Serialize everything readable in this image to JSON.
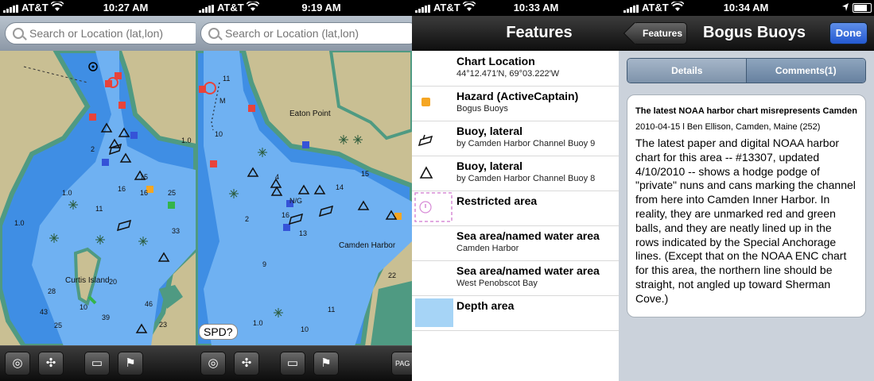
{
  "screens": {
    "map1": {
      "status": {
        "carrier": "AT&T",
        "time": "10:27 AM"
      },
      "search": {
        "placeholder": "Search or Location (lat,lon)"
      },
      "map": {
        "depth_soundings": [
          "1.0",
          "1.0",
          "2",
          "16",
          "11",
          "1.0",
          "15",
          "16",
          "25",
          "33",
          "28",
          "20",
          "43",
          "10",
          "46",
          "39",
          "25",
          "23"
        ],
        "place_labels": [
          "Curtis Island"
        ]
      },
      "toolbar": {
        "buttons": [
          "locate-icon",
          "crosshair-icon",
          "ruler-icon",
          "flag-icon"
        ]
      }
    },
    "map2": {
      "status": {
        "carrier": "AT&T",
        "time": "9:19 AM"
      },
      "search": {
        "placeholder": "Search or Location (lat,lon)"
      },
      "map": {
        "depth_soundings": [
          "11",
          "M",
          "10",
          "15",
          "14",
          "2",
          "9",
          "16",
          "13",
          "4",
          "22",
          "11",
          "1.0",
          "10"
        ],
        "place_labels": [
          "Eaton Point",
          "Camden Harbor",
          "N/G"
        ]
      },
      "speed_label": "SPD?",
      "toolbar": {
        "buttons": [
          "locate-icon",
          "crosshair-icon",
          "ruler-icon",
          "flag-icon"
        ],
        "partial_label": "PAG"
      }
    },
    "features": {
      "status": {
        "carrier": "AT&T",
        "time": "10:33 AM"
      },
      "title": "Features",
      "items": [
        {
          "icon": "none",
          "title": "Chart Location",
          "subtitle": "44°12.471′N, 69°03.222′W"
        },
        {
          "icon": "hazard-marker-icon",
          "title": "Hazard (ActiveCaptain)",
          "subtitle": "Bogus Buoys"
        },
        {
          "icon": "can-buoy-icon",
          "title": "Buoy, lateral",
          "subtitle": "by Camden Harbor Channel Buoy 9"
        },
        {
          "icon": "nun-buoy-icon",
          "title": "Buoy, lateral",
          "subtitle": "by Camden Harbor Channel Buoy 8"
        },
        {
          "icon": "restricted-area-icon",
          "title": "Restricted area",
          "subtitle": ""
        },
        {
          "icon": "none",
          "title": "Sea area/named water area",
          "subtitle": "Camden Harbor"
        },
        {
          "icon": "none",
          "title": "Sea area/named water area",
          "subtitle": "West Penobscot Bay"
        },
        {
          "icon": "depth-area-swatch-icon",
          "title": "Depth area",
          "subtitle": ""
        }
      ]
    },
    "detail": {
      "status": {
        "carrier": "AT&T",
        "time": "10:34 AM"
      },
      "back_label": "Features",
      "title": "Bogus Buoys",
      "done_label": "Done",
      "tabs": [
        "Details",
        "Comments(1)"
      ],
      "comment": {
        "heading": "The latest NOAA harbor chart misrepresents Camden…",
        "meta": "2010-04-15 l Ben Ellison, Camden, Maine (252)",
        "body": "The latest paper and digital NOAA harbor chart for this area -- #13307, updated 4/10/2010 -- shows a hodge podge of \"private\" nuns and cans marking the channel from here into Camden Inner Harbor.  In reality, they are unmarked red and green balls, and they are neatly lined up in the rows indicated by the Special Anchorage lines.  (Except that on the NOAA ENC chart for this area, the northern line should be straight, not angled up toward Sherman Cove.)"
      }
    }
  },
  "colors": {
    "land": "#c9bf93",
    "deep_water": "#6fb1f2",
    "shallow_water": "#3f8ee4",
    "foreshore": "#4f9a82",
    "hazard": "#f5a623",
    "nav_red": "#e8433b",
    "nav_blue": "#3553d8",
    "ios_blue": "#2b62d6"
  }
}
